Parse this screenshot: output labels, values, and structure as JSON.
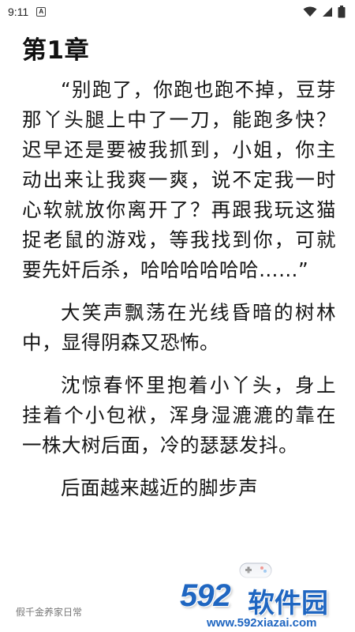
{
  "status_bar": {
    "time": "9:11",
    "notification_icon": "app-notification-icon",
    "wifi_icon": "wifi-icon",
    "signal_icon": "cell-signal-icon",
    "battery_icon": "battery-icon"
  },
  "chapter": {
    "title": "第1章"
  },
  "paragraphs": [
    "“别跑了，你跑也跑不掉，豆芽那丫头腿上中了一刀，能跑多快？迟早还是要被我抓到，小姐，你主动出来让我爽一爽，说不定我一时心软就放你离开了？再跟我玩这猫捉老鼠的游戏，等我找到你，可就要先奸后杀，哈哈哈哈哈哈……”",
    "大笑声飘荡在光线昏暗的树林中，显得阴森又恐怖。",
    "沈惊春怀里抱着小丫头，身上挂着个小包袱，浑身湿漉漉的靠在一株大树后面，冷的瑟瑟发抖。",
    "后面越来越近的脚步声"
  ],
  "footer": {
    "book_title": "假千金养家日常"
  },
  "watermark": {
    "logo": "592",
    "name": "软件园",
    "url": "www.592xiazai.com",
    "color": "#1f66c1"
  }
}
